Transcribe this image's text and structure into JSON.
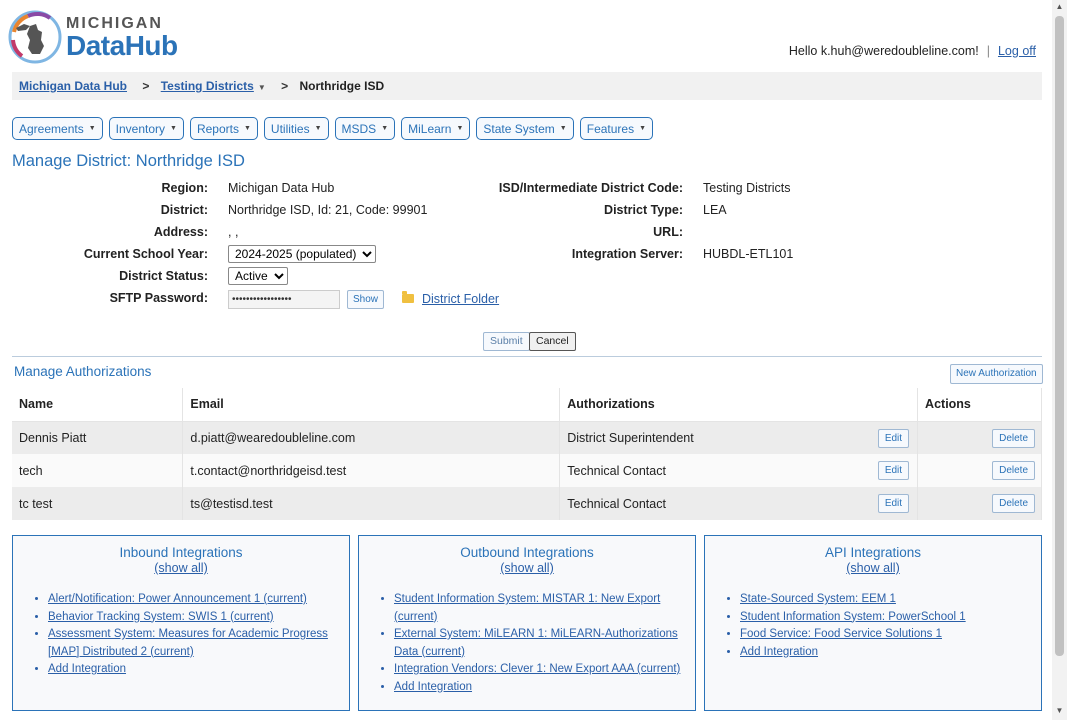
{
  "header": {
    "logo_top": "MICHIGAN",
    "logo_bottom": "DataHub",
    "greeting": "Hello k.huh@weredoubleline.com!",
    "logoff": "Log off"
  },
  "breadcrumb": {
    "root": "Michigan Data Hub",
    "middle": "Testing Districts",
    "current": "Northridge ISD",
    "separator": ">"
  },
  "menu": [
    {
      "label": "Agreements"
    },
    {
      "label": "Inventory"
    },
    {
      "label": "Reports"
    },
    {
      "label": "Utilities"
    },
    {
      "label": "MSDS"
    },
    {
      "label": "MiLearn"
    },
    {
      "label": "State System"
    },
    {
      "label": "Features"
    }
  ],
  "page_title": "Manage District: Northridge ISD",
  "form": {
    "region_label": "Region:",
    "region_value": "Michigan Data Hub",
    "district_label": "District:",
    "district_value": "Northridge ISD, Id: 21, Code: 99901",
    "address_label": "Address:",
    "address_value": ", ,",
    "school_year_label": "Current School Year:",
    "school_year_value": "2024-2025 (populated)",
    "status_label": "District Status:",
    "status_value": "Active",
    "sftp_label": "SFTP Password:",
    "sftp_value": "•••••••••••••••••",
    "show_label": "Show",
    "folder_label": "District Folder",
    "isd_label": "ISD/Intermediate District Code:",
    "isd_value": "Testing Districts",
    "type_label": "District Type:",
    "type_value": "LEA",
    "url_label": "URL:",
    "url_value": "",
    "server_label": "Integration Server:",
    "server_value": "HUBDL-ETL101",
    "submit_label": "Submit",
    "cancel_label": "Cancel"
  },
  "authorizations": {
    "title": "Manage Authorizations",
    "new_label": "New Authorization",
    "columns": [
      "Name",
      "Email",
      "Authorizations",
      "Actions"
    ],
    "edit_label": "Edit",
    "delete_label": "Delete",
    "rows": [
      {
        "name": "Dennis Piatt",
        "email": "d.piatt@wearedoubleline.com",
        "auth": "District Superintendent"
      },
      {
        "name": "tech",
        "email": "t.contact@northridgeisd.test",
        "auth": "Technical Contact"
      },
      {
        "name": "tc test",
        "email": "ts@testisd.test",
        "auth": "Technical Contact"
      }
    ]
  },
  "panels": {
    "show_all": "(show all)",
    "inbound": {
      "title": "Inbound Integrations",
      "items": [
        "Alert/Notification: Power Announcement 1 (current)",
        "Behavior Tracking System: SWIS 1 (current)",
        "Assessment System: Measures for Academic Progress [MAP] Distributed 2 (current)",
        "Add Integration"
      ]
    },
    "outbound": {
      "title": "Outbound Integrations",
      "items": [
        "Student Information System: MISTAR 1: New Export (current)",
        "External System: MiLEARN 1: MiLEARN-Authorizations Data (current)",
        "Integration Vendors: Clever 1: New Export AAA (current)",
        "Add Integration"
      ]
    },
    "api": {
      "title": "API Integrations",
      "items": [
        "State-Sourced System: EEM 1",
        "Student Information System: PowerSchool 1",
        "Food Service: Food Service Solutions 1",
        "Add Integration"
      ]
    }
  },
  "colors": {
    "accent": "#2b73b8",
    "link": "#2a5fa8",
    "row_alt": "#ececec"
  }
}
